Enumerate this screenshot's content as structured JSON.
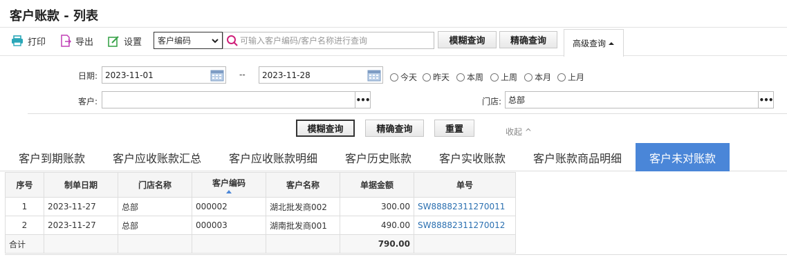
{
  "page_title": "客户账款 - 列表",
  "toolbar": {
    "print_label": "打印",
    "export_label": "导出",
    "settings_label": "设置",
    "search_field_select": "客户编码",
    "search_placeholder": "可输入客户编码/客户名称进行查询",
    "fuzzy_query_label": "模糊查询",
    "exact_query_label": "精确查询",
    "advanced_query_label": "高级查询"
  },
  "filters": {
    "date_label": "日期:",
    "date_from": "2023-11-01",
    "date_separator": "--",
    "date_to": "2023-11-28",
    "quick_dates": [
      "今天",
      "昨天",
      "本周",
      "上周",
      "本月",
      "上月"
    ],
    "customer_label": "客户:",
    "customer_value": "",
    "store_label": "门店:",
    "store_value": "总部",
    "fuzzy_query_label": "模糊查询",
    "exact_query_label": "精确查询",
    "reset_label": "重置",
    "collapse_label": "收起 ^"
  },
  "tabs": [
    "客户到期账款",
    "客户应收账款汇总",
    "客户应收账款明细",
    "客户历史账款",
    "客户实收账款",
    "客户账款商品明细",
    "客户未对账款"
  ],
  "active_tab_index": 6,
  "table": {
    "columns": [
      "序号",
      "制单日期",
      "门店名称",
      "客户编码",
      "客户名称",
      "单据金额",
      "单号"
    ],
    "rows": [
      [
        "1",
        "2023-11-27",
        "总部",
        "000002",
        "湖北批发商002",
        "300.00",
        "SW88882311270011"
      ],
      [
        "2",
        "2023-11-27",
        "总部",
        "000003",
        "湖南批发商001",
        "490.00",
        "SW88882311270012"
      ]
    ],
    "total_label": "合计",
    "total_amount": "790.00"
  },
  "colors": {
    "accent": "#4a86d8",
    "link": "#2a6fb0"
  }
}
